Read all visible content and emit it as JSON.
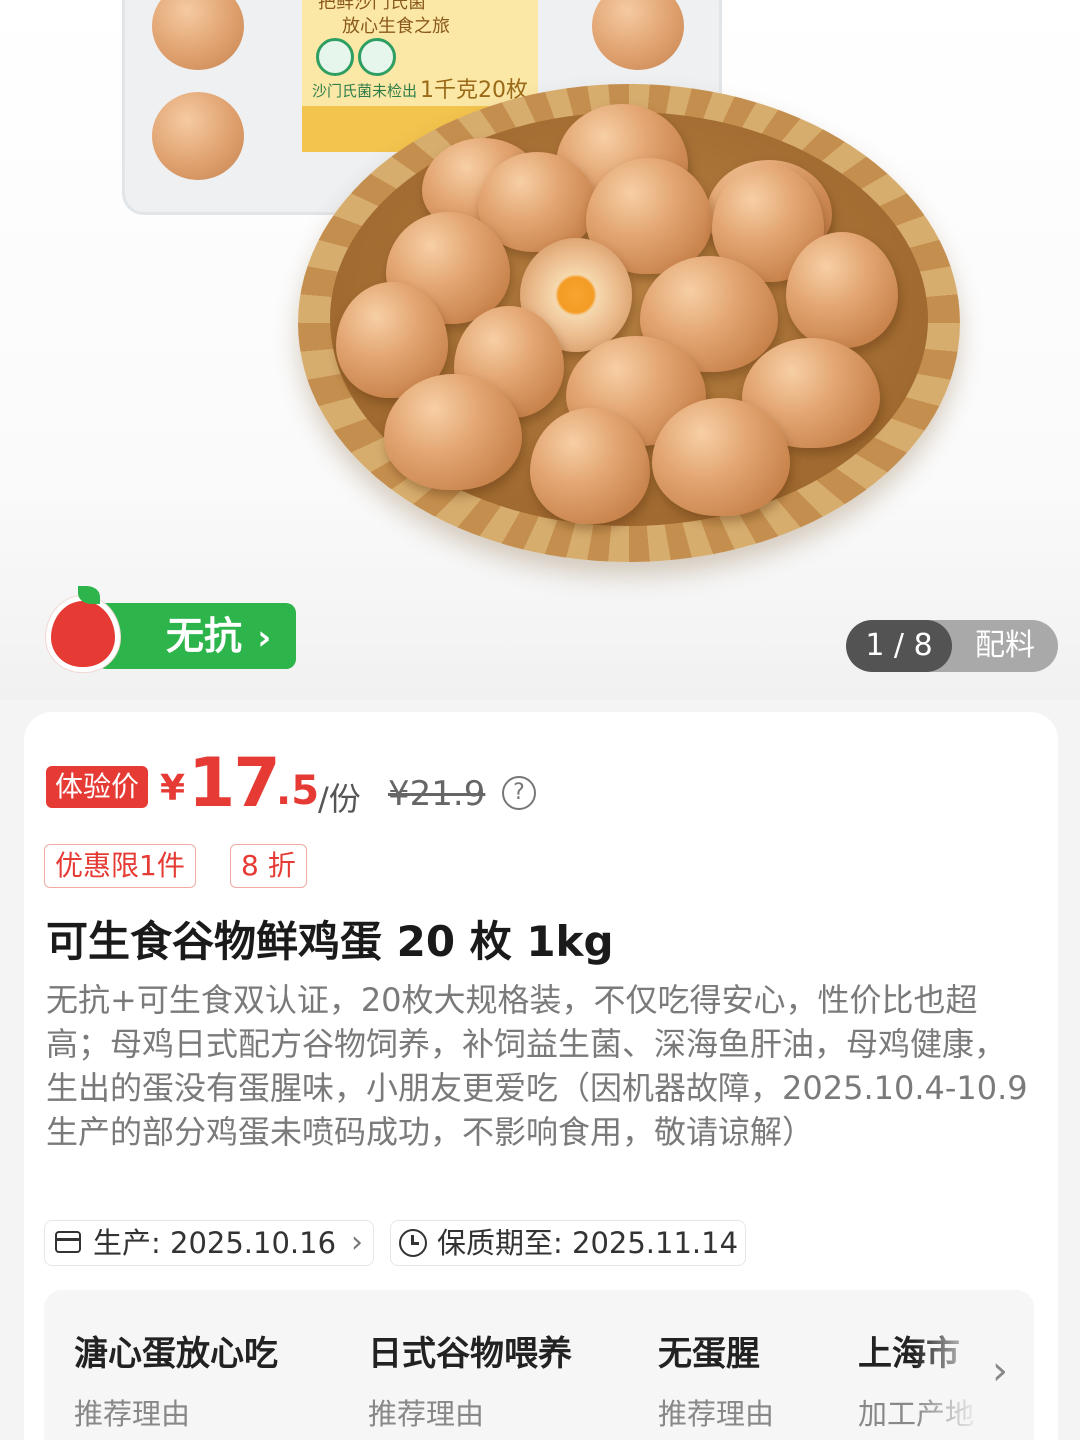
{
  "hero": {
    "package_label": {
      "line1": "把鲜沙门氏菌",
      "line2": "放心生食之旅",
      "line3": "沙门氏菌未检出",
      "count": "1千克20枚"
    },
    "badge": {
      "label": "无抗",
      "chevron": "›"
    },
    "counter": {
      "index": "1 / 8",
      "tag": "配料"
    }
  },
  "price": {
    "label": "体验价",
    "currency": "¥",
    "integer": "17",
    "decimal": ".5",
    "unit": "/份",
    "original": "¥21.9",
    "help": "?"
  },
  "promos": [
    "优惠限1件",
    "8 折"
  ],
  "product": {
    "title": "可生食谷物鲜鸡蛋 20 枚 1kg",
    "description": "无抗+可生食双认证，20枚大规格装，不仅吃得安心，性价比也超高；母鸡日式配方谷物饲养，补饲益生菌、深海鱼肝油，母鸡健康，生出的蛋没有蛋腥味，小朋友更爱吃（因机器故障，2025.10.4-10.9生产的部分鸡蛋未喷码成功，不影响食用，敬请谅解）"
  },
  "dates": {
    "production": "生产: 2025.10.16",
    "expiry": "保质期至: 2025.11.14",
    "chevron": "›"
  },
  "reasons": [
    {
      "title": "溏心蛋放心吃",
      "subtitle": "推荐理由"
    },
    {
      "title": "日式谷物喂养",
      "subtitle": "推荐理由"
    },
    {
      "title": "无蛋腥",
      "subtitle": "推荐理由"
    },
    {
      "title": "上海市",
      "subtitle": "加工产地"
    }
  ],
  "colors": {
    "accent_red": "#e63a34",
    "badge_green": "#2db54c"
  }
}
